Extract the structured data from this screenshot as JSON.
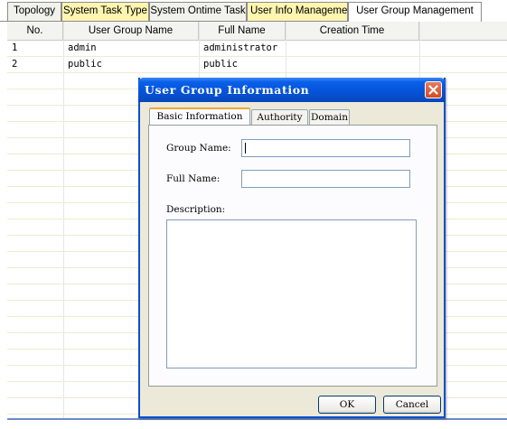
{
  "tabs": [
    {
      "label": "Topology"
    },
    {
      "label": "System Task Type"
    },
    {
      "label": "System Ontime Task"
    },
    {
      "label": "User Info Management"
    },
    {
      "label": "User Group Management"
    }
  ],
  "table": {
    "columns": [
      "No.",
      "User Group Name",
      "Full Name",
      "Creation Time"
    ],
    "rows": [
      {
        "no": "1",
        "group": "admin",
        "full": "administrator",
        "time": ""
      },
      {
        "no": "2",
        "group": "public",
        "full": "public",
        "time": ""
      }
    ]
  },
  "dialog": {
    "title": "User Group Information",
    "tabs": [
      {
        "label": "Basic Information"
      },
      {
        "label": "Authority"
      },
      {
        "label": "Domain"
      }
    ],
    "group_name_label": "Group Name:",
    "group_name_value": "",
    "full_name_label": "Full Name:",
    "full_name_value": "",
    "description_label": "Description:",
    "description_value": "",
    "ok_label": "OK",
    "cancel_label": "Cancel"
  },
  "colors": {
    "titlebar": "#0552d8",
    "highlight_tab": "#fdf5b0",
    "close_button": "#d24a23"
  }
}
